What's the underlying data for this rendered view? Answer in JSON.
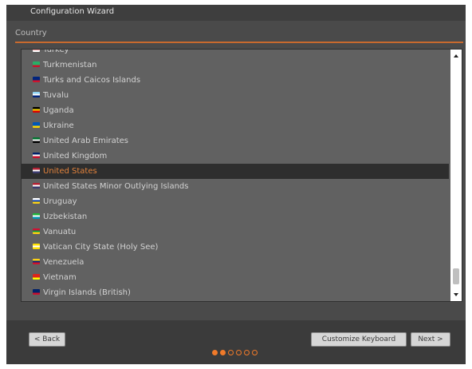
{
  "window": {
    "title": "Configuration Wizard"
  },
  "section": {
    "label": "Country"
  },
  "countries": [
    {
      "label": "Turkey",
      "flag": [
        "#d8232a",
        "#d8232a",
        "#ffffff"
      ],
      "selected": false
    },
    {
      "label": "Turkmenistan",
      "flag": [
        "#28ae66",
        "#28ae66",
        "#c8102e"
      ],
      "selected": false
    },
    {
      "label": "Turks and Caicos Islands",
      "flag": [
        "#00247d",
        "#00247d",
        "#cf142b"
      ],
      "selected": false
    },
    {
      "label": "Tuvalu",
      "flag": [
        "#8fd3f5",
        "#ffffff",
        "#00247d"
      ],
      "selected": false
    },
    {
      "label": "Uganda",
      "flag": [
        "#000000",
        "#fcdc04",
        "#d90000"
      ],
      "selected": false
    },
    {
      "label": "Ukraine",
      "flag": [
        "#0057b7",
        "#0057b7",
        "#ffd700"
      ],
      "selected": false
    },
    {
      "label": "United Arab Emirates",
      "flag": [
        "#00732f",
        "#ffffff",
        "#000000"
      ],
      "selected": false
    },
    {
      "label": "United Kingdom",
      "flag": [
        "#012169",
        "#ffffff",
        "#c8102e"
      ],
      "selected": false
    },
    {
      "label": "United States",
      "flag": [
        "#b22234",
        "#ffffff",
        "#3c3b6e"
      ],
      "selected": true
    },
    {
      "label": "United States Minor Outlying Islands",
      "flag": [
        "#b22234",
        "#ffffff",
        "#3c3b6e"
      ],
      "selected": false
    },
    {
      "label": "Uruguay",
      "flag": [
        "#ffffff",
        "#0038a8",
        "#fcd116"
      ],
      "selected": false
    },
    {
      "label": "Uzbekistan",
      "flag": [
        "#1eb53a",
        "#ffffff",
        "#0099b5"
      ],
      "selected": false
    },
    {
      "label": "Vanuatu",
      "flag": [
        "#d21034",
        "#009543",
        "#fdce12"
      ],
      "selected": false
    },
    {
      "label": "Vatican City State (Holy See)",
      "flag": [
        "#ffe000",
        "#ffffff",
        "#ffe000"
      ],
      "selected": false
    },
    {
      "label": "Venezuela",
      "flag": [
        "#fcd116",
        "#00247d",
        "#cf142b"
      ],
      "selected": false
    },
    {
      "label": "Vietnam",
      "flag": [
        "#da251d",
        "#da251d",
        "#ffff00"
      ],
      "selected": false
    },
    {
      "label": "Virgin Islands (British)",
      "flag": [
        "#012169",
        "#012169",
        "#c8102e"
      ],
      "selected": false
    }
  ],
  "buttons": {
    "back": "< Back",
    "customize": "Customize Keyboard",
    "next": "Next >"
  },
  "progress": {
    "total": 6,
    "filled": 2
  },
  "colors": {
    "accent": "#f07a2a",
    "selection_text": "#e2823c"
  }
}
